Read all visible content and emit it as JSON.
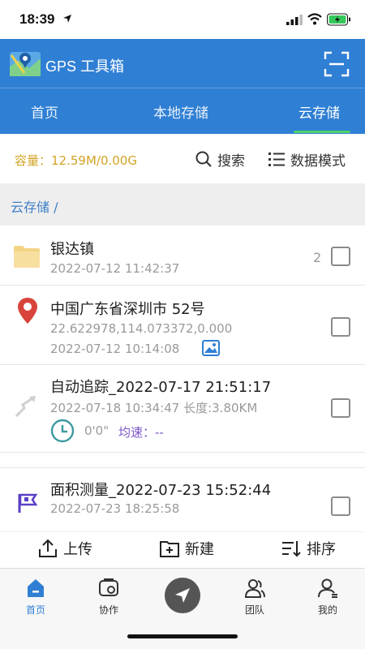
{
  "status": {
    "time": "18:39"
  },
  "app": {
    "title": "GPS 工具箱"
  },
  "tabs": [
    {
      "label": "首页"
    },
    {
      "label": "本地存储"
    },
    {
      "label": "云存储"
    }
  ],
  "info": {
    "capacity": "容量：12.59M/0.00G",
    "search": "搜索",
    "mode": "数据模式"
  },
  "breadcrumb": "云存储 /",
  "items": [
    {
      "title": "银达镇",
      "datetime": "2022-07-12 11:42:37",
      "count": "2"
    },
    {
      "title": "中国广东省深圳市 52号",
      "coords": "22.622978,114.073372,0.000",
      "datetime": "2022-07-12 10:14:08"
    },
    {
      "title": "自动追踪_2022-07-17 21:51:17",
      "meta": "2022-07-18 10:34:47 长度:3.80KM",
      "duration": "0'0\"",
      "speed": "均速：--"
    },
    {
      "title": "面积测量_2022-07-23 15:52:44",
      "datetime": "2022-07-23 18:25:58"
    }
  ],
  "actions": {
    "upload": "上传",
    "create": "新建",
    "sort": "排序"
  },
  "nav": [
    {
      "label": "首页"
    },
    {
      "label": "协作"
    },
    {
      "label": "团队"
    },
    {
      "label": "我的"
    }
  ],
  "colors": {
    "primary": "#2f7fd4",
    "accent_green": "#4fd36b",
    "capacity": "#d2a424",
    "speed": "#7b56c9"
  }
}
